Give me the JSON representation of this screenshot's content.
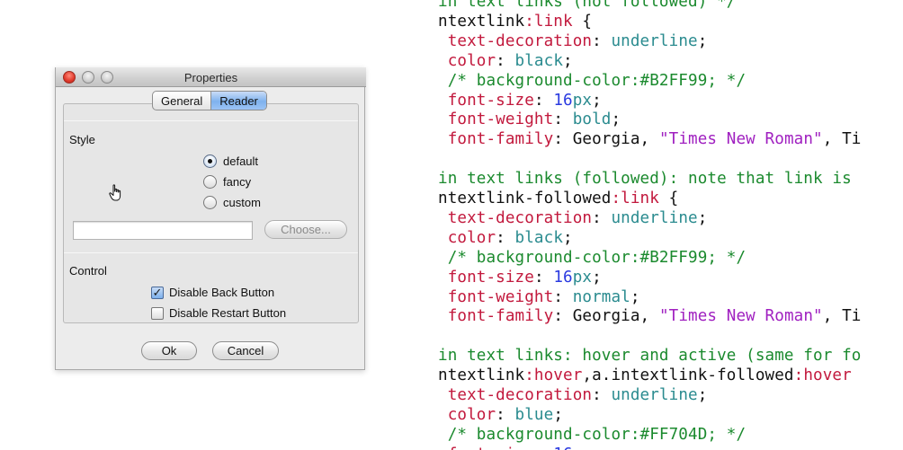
{
  "dialog": {
    "title": "Properties",
    "tabs": [
      {
        "label": "General",
        "active": false
      },
      {
        "label": "Reader",
        "active": true
      }
    ],
    "style_section": {
      "label": "Style",
      "options": [
        {
          "label": "default",
          "selected": true
        },
        {
          "label": "fancy",
          "selected": false
        },
        {
          "label": "custom",
          "selected": false
        }
      ],
      "path_value": "",
      "choose_label": "Choose..."
    },
    "control_section": {
      "label": "Control",
      "checkboxes": [
        {
          "label": "Disable Back Button",
          "checked": true
        },
        {
          "label": "Disable Restart Button",
          "checked": false
        }
      ]
    },
    "ok_label": "Ok",
    "cancel_label": "Cancel"
  },
  "code": {
    "lines": [
      [
        {
          "t": "in text links (not followed) */",
          "c": "cmt"
        }
      ],
      [
        {
          "t": "ntextlink",
          "c": "pun"
        },
        {
          "t": ":link",
          "c": "prop"
        },
        {
          "t": " {",
          "c": "pun"
        }
      ],
      [
        {
          "t": " text-decoration",
          "c": "prop"
        },
        {
          "t": ": ",
          "c": "pun"
        },
        {
          "t": "underline",
          "c": "kw"
        },
        {
          "t": ";",
          "c": "pun"
        }
      ],
      [
        {
          "t": " color",
          "c": "prop"
        },
        {
          "t": ": ",
          "c": "pun"
        },
        {
          "t": "black",
          "c": "kw"
        },
        {
          "t": ";",
          "c": "pun"
        }
      ],
      [
        {
          "t": " /* background-color:#B2FF99; */",
          "c": "cmt"
        }
      ],
      [
        {
          "t": " font-size",
          "c": "prop"
        },
        {
          "t": ": ",
          "c": "pun"
        },
        {
          "t": "16",
          "c": "num"
        },
        {
          "t": "px",
          "c": "kw"
        },
        {
          "t": ";",
          "c": "pun"
        }
      ],
      [
        {
          "t": " font-weight",
          "c": "prop"
        },
        {
          "t": ": ",
          "c": "pun"
        },
        {
          "t": "bold",
          "c": "kw"
        },
        {
          "t": ";",
          "c": "pun"
        }
      ],
      [
        {
          "t": " font-family",
          "c": "prop"
        },
        {
          "t": ": Georgia, ",
          "c": "pun"
        },
        {
          "t": "\"Times New Roman\"",
          "c": "str"
        },
        {
          "t": ", Ti",
          "c": "pun"
        }
      ],
      [
        {
          "t": "",
          "c": "pun"
        }
      ],
      [
        {
          "t": "in text links (followed): note that link is",
          "c": "cmt"
        }
      ],
      [
        {
          "t": "ntextlink-followed",
          "c": "pun"
        },
        {
          "t": ":link",
          "c": "prop"
        },
        {
          "t": " {",
          "c": "pun"
        }
      ],
      [
        {
          "t": " text-decoration",
          "c": "prop"
        },
        {
          "t": ": ",
          "c": "pun"
        },
        {
          "t": "underline",
          "c": "kw"
        },
        {
          "t": ";",
          "c": "pun"
        }
      ],
      [
        {
          "t": " color",
          "c": "prop"
        },
        {
          "t": ": ",
          "c": "pun"
        },
        {
          "t": "black",
          "c": "kw"
        },
        {
          "t": ";",
          "c": "pun"
        }
      ],
      [
        {
          "t": " /* background-color:#B2FF99; */",
          "c": "cmt"
        }
      ],
      [
        {
          "t": " font-size",
          "c": "prop"
        },
        {
          "t": ": ",
          "c": "pun"
        },
        {
          "t": "16",
          "c": "num"
        },
        {
          "t": "px",
          "c": "kw"
        },
        {
          "t": ";",
          "c": "pun"
        }
      ],
      [
        {
          "t": " font-weight",
          "c": "prop"
        },
        {
          "t": ": ",
          "c": "pun"
        },
        {
          "t": "normal",
          "c": "kw"
        },
        {
          "t": ";",
          "c": "pun"
        }
      ],
      [
        {
          "t": " font-family",
          "c": "prop"
        },
        {
          "t": ": Georgia, ",
          "c": "pun"
        },
        {
          "t": "\"Times New Roman\"",
          "c": "str"
        },
        {
          "t": ", Ti",
          "c": "pun"
        }
      ],
      [
        {
          "t": "",
          "c": "pun"
        }
      ],
      [
        {
          "t": "in text links: hover and active (same for fo",
          "c": "cmt"
        }
      ],
      [
        {
          "t": "ntextlink",
          "c": "pun"
        },
        {
          "t": ":hover",
          "c": "prop"
        },
        {
          "t": ",a.intextlink-followed",
          "c": "pun"
        },
        {
          "t": ":hover",
          "c": "prop"
        }
      ],
      [
        {
          "t": " text-decoration",
          "c": "prop"
        },
        {
          "t": ": ",
          "c": "pun"
        },
        {
          "t": "underline",
          "c": "kw"
        },
        {
          "t": ";",
          "c": "pun"
        }
      ],
      [
        {
          "t": " color",
          "c": "prop"
        },
        {
          "t": ": ",
          "c": "pun"
        },
        {
          "t": "blue",
          "c": "kw"
        },
        {
          "t": ";",
          "c": "pun"
        }
      ],
      [
        {
          "t": " /* background-color:#FF704D; */",
          "c": "cmt"
        }
      ],
      [
        {
          "t": " font-size",
          "c": "prop"
        },
        {
          "t": ": ",
          "c": "pun"
        },
        {
          "t": "16",
          "c": "num"
        },
        {
          "t": "px",
          "c": "kw"
        },
        {
          "t": ";",
          "c": "pun"
        }
      ]
    ]
  },
  "colors": {
    "property": "#c2193d",
    "keyword": "#2a8b8f",
    "number": "#2a3ae0",
    "string": "#a020c0",
    "comment": "#1b8a2e",
    "selection": "#7fb2ee"
  }
}
